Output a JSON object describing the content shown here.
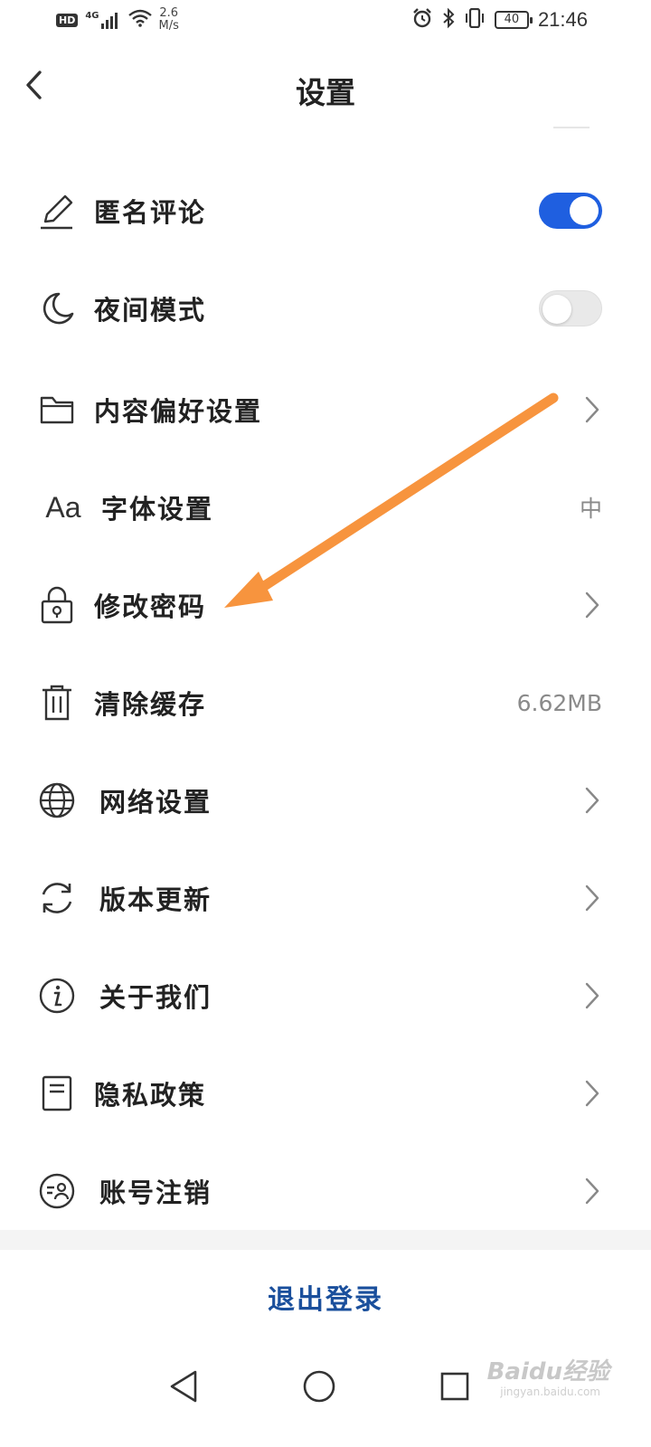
{
  "status_bar": {
    "hd": "HD",
    "signal": "4G",
    "speed_value": "2.6",
    "speed_unit": "M/s",
    "battery": "40",
    "time": "21:46"
  },
  "header": {
    "title": "设置"
  },
  "settings": [
    {
      "label": "匿名评论",
      "icon": "pencil-icon",
      "control": "toggle",
      "enabled": true
    },
    {
      "label": "夜间模式",
      "icon": "moon-icon",
      "control": "toggle",
      "enabled": false
    },
    {
      "label": "内容偏好设置",
      "icon": "folder-icon",
      "control": "chevron"
    },
    {
      "label": "字体设置",
      "icon": "font-icon",
      "icon_text": "Aa",
      "control": "value",
      "value": "中"
    },
    {
      "label": "修改密码",
      "icon": "lock-icon",
      "control": "chevron"
    },
    {
      "label": "清除缓存",
      "icon": "trash-icon",
      "control": "value",
      "value": "6.62MB"
    },
    {
      "label": "网络设置",
      "icon": "globe-icon",
      "control": "chevron"
    },
    {
      "label": "版本更新",
      "icon": "refresh-icon",
      "control": "chevron"
    },
    {
      "label": "关于我们",
      "icon": "info-icon",
      "control": "chevron"
    },
    {
      "label": "隐私政策",
      "icon": "document-icon",
      "control": "chevron"
    },
    {
      "label": "账号注销",
      "icon": "account-cancel-icon",
      "control": "chevron"
    }
  ],
  "logout_label": "退出登录",
  "watermark": {
    "brand": "Baidu经验",
    "url": "jingyan.baidu.com"
  },
  "colors": {
    "toggle_on": "#1f5fe0",
    "logout_text": "#1a4f9c",
    "annotation_arrow": "#f7943e"
  }
}
